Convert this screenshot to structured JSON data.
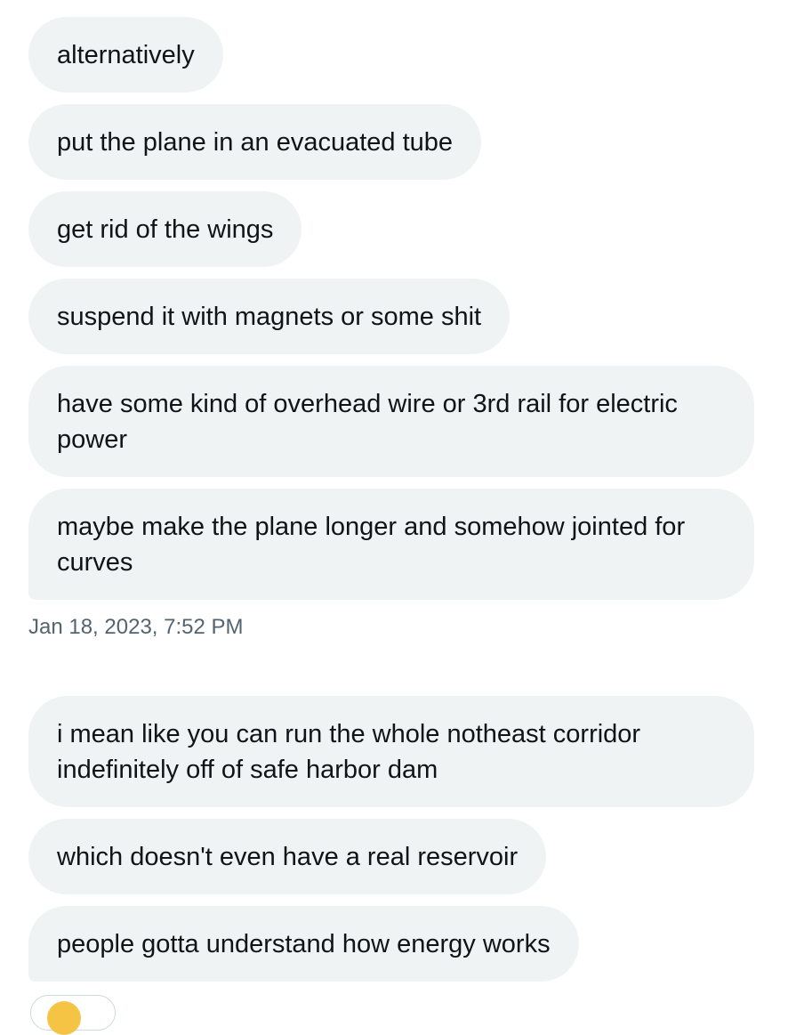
{
  "group1": {
    "messages": [
      "alternatively",
      "put the plane in an evacuated tube",
      "get rid of the wings",
      "suspend it with magnets or some shit",
      "have some kind of overhead wire or 3rd rail for electric power",
      "maybe make the plane longer and somehow jointed for curves"
    ],
    "timestamp": "Jan 18, 2023, 7:52 PM"
  },
  "group2": {
    "messages": [
      "i mean like you can run the whole notheast corridor indefinitely off of safe harbor dam",
      "which doesn't even have a real reservoir",
      "people gotta understand how energy works"
    ]
  },
  "reaction": {
    "icon": "emoji-reaction-icon",
    "color": "#f6c445"
  },
  "colors": {
    "bubble_bg": "#eff3f4",
    "text": "#0f1419",
    "timestamp": "#536471"
  }
}
